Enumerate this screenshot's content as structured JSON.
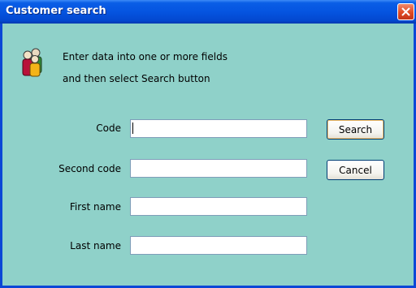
{
  "window": {
    "title": "Customer search"
  },
  "instructions": {
    "line1": "Enter data into one or more fields",
    "line2": "and then select Search button"
  },
  "fields": {
    "code": {
      "label": "Code",
      "value": ""
    },
    "second_code": {
      "label": "Second code",
      "value": ""
    },
    "first_name": {
      "label": "First name",
      "value": ""
    },
    "last_name": {
      "label": "Last name",
      "value": ""
    }
  },
  "buttons": {
    "search": "Search",
    "cancel": "Cancel"
  },
  "icons": {
    "header": "people-icon",
    "close": "close-icon"
  },
  "colors": {
    "dialog_background": "#8fd1c9",
    "titlebar": "#0554e0",
    "close_button": "#e04a22"
  }
}
